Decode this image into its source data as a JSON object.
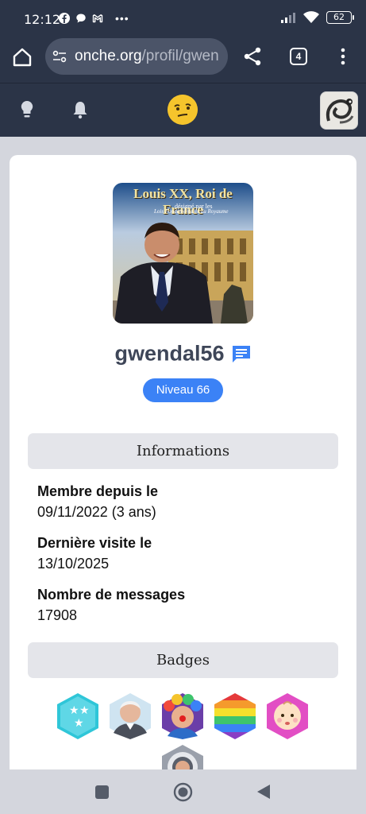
{
  "status_bar": {
    "time": "12:12",
    "battery": "62",
    "icons": [
      "facebook-icon",
      "chat-bubble-icon",
      "gmail-icon",
      "more-dots-icon",
      "signal-icon",
      "wifi-icon",
      "battery-icon"
    ]
  },
  "browser": {
    "url_host": "onche.org",
    "url_path": "/profil/gwen",
    "tab_count": "4"
  },
  "site_header": {
    "icons": [
      "bulb-icon",
      "bell-icon",
      "smiley-logo-icon",
      "user-avatar"
    ]
  },
  "profile": {
    "image_title": "Louis XX, Roi de France",
    "image_subtitle_1": "désigné par les",
    "image_subtitle_2": "Lois Fondamentales du Royaume",
    "username": "gwendal56",
    "level": "Niveau 66"
  },
  "informations": {
    "heading": "Informations",
    "items": [
      {
        "label": "Membre depuis le",
        "value": "09/11/2022 (3 ans)"
      },
      {
        "label": "Dernière visite le",
        "value": "13/10/2025"
      },
      {
        "label": "Nombre de messages",
        "value": "17908"
      }
    ]
  },
  "badges": {
    "heading": "Badges",
    "items": [
      "stars-badge",
      "old-man-badge",
      "clown-badge",
      "rainbow-badge",
      "baby-badge",
      "astronaut-badge"
    ]
  },
  "colors": {
    "header_bg": "#2b3447",
    "level_badge": "#3b82f6",
    "section_bg": "#e4e5ea"
  }
}
